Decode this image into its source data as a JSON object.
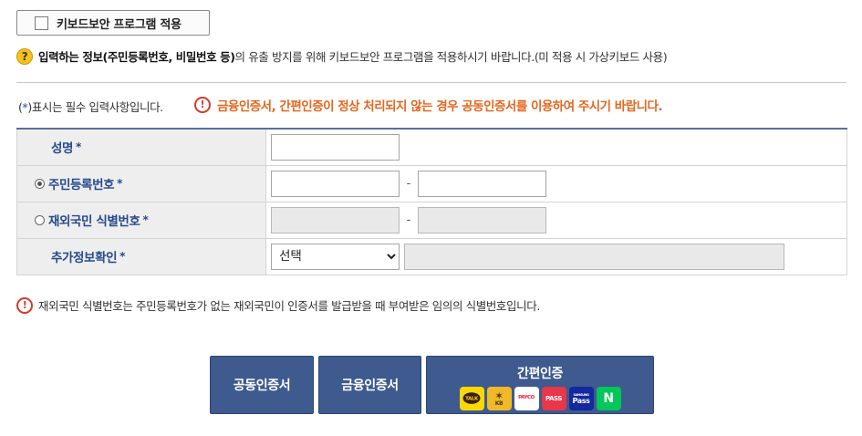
{
  "keyboard_security": {
    "label": "키보드보안 프로그램 적용",
    "checked": false
  },
  "notice_keyboard": {
    "bold_part": "입력하는 정보(주민등록번호, 비밀번호 등)",
    "rest": "의 유출 방지를 위해 키보드보안 프로그램을 적용하시기 바랍니다.(미 적용 시 가상키보드 사용)"
  },
  "required_note": {
    "open": "(",
    "star": "*",
    "close": ")",
    "text": "표시는 필수 입력사항입니다."
  },
  "warning": {
    "text": "금융인증서, 간편인증이 정상 처리되지 않는 경우 공동인증서를 이용하여 주시기 바랍니다."
  },
  "form": {
    "required_mark": "*",
    "name_label": "성명",
    "name_value": "",
    "rrn": {
      "label": "주민등록번호",
      "selected": true,
      "part1": "",
      "part2": "",
      "separator": "-"
    },
    "foreigner": {
      "label": "재외국민 식별번호",
      "selected": false,
      "part1": "",
      "part2": "",
      "separator": "-"
    },
    "extra": {
      "label": "추가정보확인",
      "select_value": "선택",
      "detail": ""
    }
  },
  "notice_foreigner": {
    "text": "재외국민 식별번호는 주민등록번호가 없는 재외국민이 인증서를 발급받을 때 부여받은 임의의 식별번호입니다."
  },
  "buttons": {
    "joint_cert": "공동인증서",
    "financial_cert": "금융인증서",
    "simple_auth": "간편인증",
    "simple_auth_providers": {
      "kakao": "TALK",
      "kb": "KB",
      "payco": "PAYCO",
      "pass": "PASS",
      "samsung_pass_top": "SAMSUNG",
      "samsung_pass": "Pass",
      "naver": "N"
    }
  },
  "colors": {
    "accent_navy": "#3e5a8e",
    "label_blue": "#274a8c",
    "warning_orange": "#e5661f",
    "error_red": "#d23a2b",
    "help_yellow": "#f7c21c"
  }
}
